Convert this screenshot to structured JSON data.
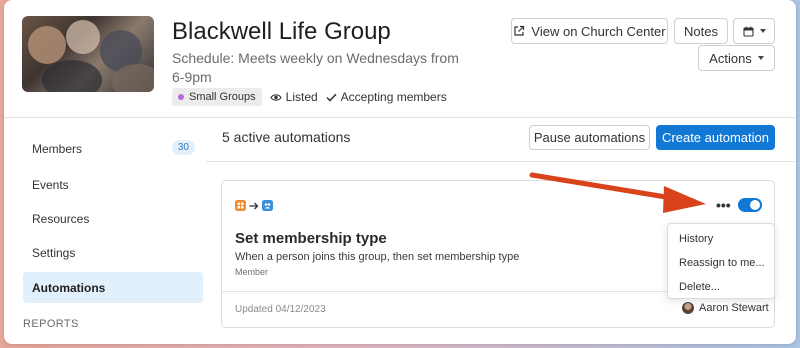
{
  "header": {
    "title": "Blackwell Life Group",
    "schedule": "Schedule: Meets weekly on Wednesdays from 6-9pm",
    "tags": {
      "group_type": "Small Groups",
      "listed": "Listed",
      "accepting": "Accepting members"
    },
    "buttons": {
      "church_center": "View on Church Center",
      "notes": "Notes",
      "actions": "Actions"
    }
  },
  "sidebar": {
    "items": [
      {
        "label": "Members",
        "count": "30"
      },
      {
        "label": "Events"
      },
      {
        "label": "Resources"
      },
      {
        "label": "Settings"
      },
      {
        "label": "Automations"
      }
    ],
    "section_heading": "REPORTS"
  },
  "main": {
    "active_count": "5 active automations",
    "pause_button": "Pause automations",
    "create_button": "Create automation"
  },
  "card": {
    "title": "Set membership type",
    "description": "When a person joins this group, then set membership type",
    "sub": "Member",
    "updated": "Updated 04/12/2023",
    "owner": "Aaron Stewart",
    "menu_dots": "•••",
    "toggle_on": true
  },
  "menu": {
    "items": [
      "History",
      "Reassign to me...",
      "Delete..."
    ]
  },
  "colors": {
    "primary": "#1278d6",
    "active_bg": "#e2f0fc",
    "annotation_arrow": "#d9431c",
    "tag_dot": "#b76ad6"
  }
}
